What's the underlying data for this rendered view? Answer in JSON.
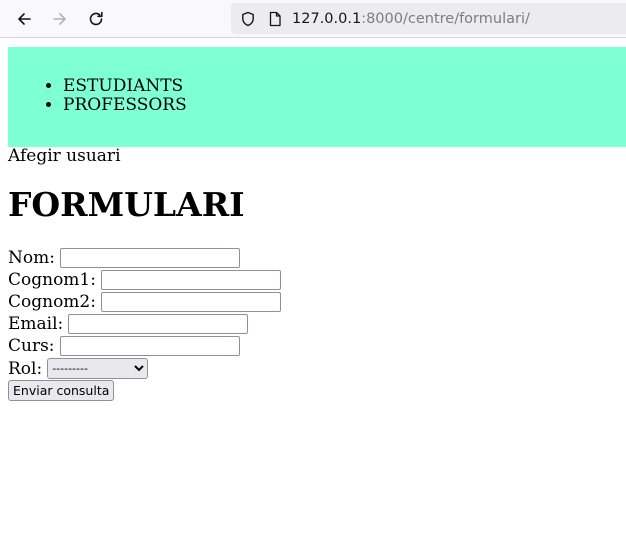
{
  "browser": {
    "url_host": "127.0.0.1",
    "url_rest": ":8000/centre/formulari/"
  },
  "menu": {
    "items": [
      {
        "label": "ESTUDIANTS"
      },
      {
        "label": "PROFESSORS"
      }
    ]
  },
  "add_user_label": "Afegir usuari",
  "form": {
    "title": "FORMULARI",
    "fields": {
      "nom": {
        "label": "Nom:",
        "value": ""
      },
      "cognom1": {
        "label": "Cognom1:",
        "value": ""
      },
      "cognom2": {
        "label": "Cognom2:",
        "value": ""
      },
      "email": {
        "label": "Email:",
        "value": ""
      },
      "curs": {
        "label": "Curs:",
        "value": ""
      },
      "rol": {
        "label": "Rol:",
        "selected": "---------"
      }
    },
    "submit_label": "Enviar consulta"
  },
  "colors": {
    "menu_background": "#7fffd4"
  }
}
